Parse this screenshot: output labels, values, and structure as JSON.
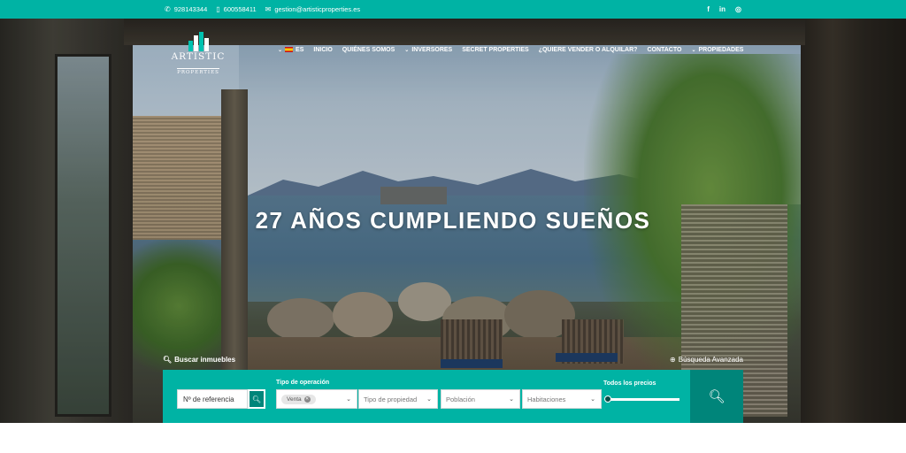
{
  "topbar": {
    "phone1": "928143344",
    "phone2": "600558411",
    "email": "gestion@artisticproperties.es",
    "social": [
      "facebook-icon",
      "linkedin-icon",
      "instagram-icon"
    ]
  },
  "logo": {
    "name": "ARTISTIC",
    "sub": "PROPERTIES"
  },
  "nav": {
    "lang": "ES",
    "items": [
      "INICIO",
      "QUIÉNES SOMOS",
      "INVERSORES",
      "SECRET PROPERTIES",
      "¿QUIERE VENDER O ALQUILAR?",
      "CONTACTO",
      "PROPIEDADES"
    ]
  },
  "hero": {
    "headline": "27 AÑOS CUMPLIENDO SUEÑOS"
  },
  "search": {
    "label": "Buscar inmuebles",
    "advanced": "Búsqueda Avanzada",
    "ref_placeholder": "Nº de referencia",
    "operation_label": "Tipo de operación",
    "operation_chip": "Venta",
    "property_type": "Tipo de propiedad",
    "town": "Población",
    "rooms": "Habitaciones",
    "price_label": "Todos los precios"
  },
  "colors": {
    "accent": "#00b3a4",
    "accent_dark": "#00857a"
  }
}
